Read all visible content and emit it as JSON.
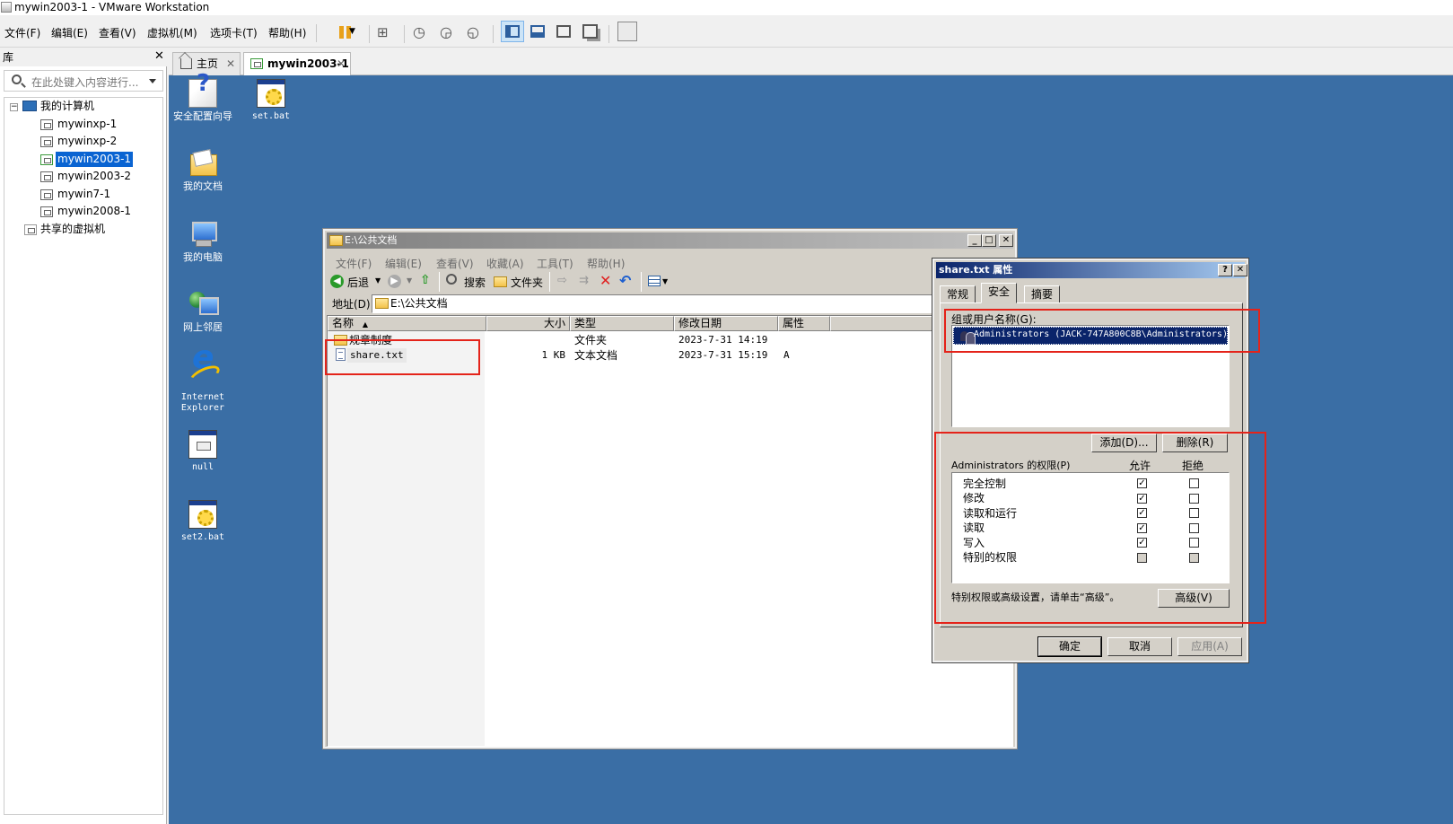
{
  "window": {
    "title": "mywin2003-1 - VMware Workstation"
  },
  "menubar": {
    "items": [
      "文件(F)",
      "编辑(E)",
      "查看(V)",
      "虚拟机(M)",
      "选项卡(T)",
      "帮助(H)"
    ]
  },
  "library": {
    "title": "库",
    "search_placeholder": "在此处键入内容进行...",
    "root": "我的计算机",
    "vms": [
      "mywinxp-1",
      "mywinxp-2",
      "mywin2003-1",
      "mywin2003-2",
      "mywin7-1",
      "mywin2008-1"
    ],
    "selected": "mywin2003-1",
    "shared": "共享的虚拟机"
  },
  "tabs": [
    {
      "label": "主页"
    },
    {
      "label": "mywin2003-1",
      "active": true
    }
  ],
  "desktop_icons": [
    {
      "label": "安全配置向导",
      "icon": "security-wizard-icon"
    },
    {
      "label": "set.bat",
      "icon": "batch-file-icon"
    },
    {
      "label": "我的文档",
      "icon": "my-documents-icon"
    },
    {
      "label": "我的电脑",
      "icon": "my-computer-icon"
    },
    {
      "label": "网上邻居",
      "icon": "network-places-icon"
    },
    {
      "label": "Internet Explorer",
      "icon": "ie-icon"
    },
    {
      "label": "null",
      "icon": "null-file-icon"
    },
    {
      "label": "set2.bat",
      "icon": "batch-file-icon"
    }
  ],
  "explorer": {
    "title": "E:\\公共文档",
    "menu": [
      "文件(F)",
      "编辑(E)",
      "查看(V)",
      "收藏(A)",
      "工具(T)",
      "帮助(H)"
    ],
    "toolbar": {
      "back": "后退",
      "search": "搜索",
      "folders": "文件夹"
    },
    "address_label": "地址(D)",
    "address_value": "E:\\公共文档",
    "columns": [
      "名称",
      "大小",
      "类型",
      "修改日期",
      "属性"
    ],
    "rows": [
      {
        "name": "规章制度",
        "size": "",
        "type": "文件夹",
        "modified": "2023-7-31 14:19",
        "attr": ""
      },
      {
        "name": "share.txt",
        "size": "1 KB",
        "type": "文本文档",
        "modified": "2023-7-31 15:19",
        "attr": "A"
      }
    ]
  },
  "properties": {
    "title": "share.txt 属性",
    "tabs": [
      "常规",
      "安全",
      "摘要"
    ],
    "active_tab": "安全",
    "group_label": "组或用户名称(G):",
    "group_entries": [
      "Administrators (JACK-747A800C8B\\Administrators)"
    ],
    "add_button": "添加(D)...",
    "remove_button": "删除(R)",
    "perm_label": "Administrators 的权限(P)",
    "allow_header": "允许",
    "deny_header": "拒绝",
    "permissions": [
      {
        "name": "完全控制",
        "allow": true,
        "deny": false
      },
      {
        "name": "修改",
        "allow": true,
        "deny": false
      },
      {
        "name": "读取和运行",
        "allow": true,
        "deny": false
      },
      {
        "name": "读取",
        "allow": true,
        "deny": false
      },
      {
        "name": "写入",
        "allow": true,
        "deny": false
      },
      {
        "name": "特别的权限",
        "allow": false,
        "deny": false
      }
    ],
    "advanced_hint": "特别权限或高级设置，请单击“高级”。",
    "advanced_button": "高级(V)",
    "ok": "确定",
    "cancel": "取消",
    "apply": "应用(A)"
  },
  "colors": {
    "desktop": "#3a6ea5",
    "annotation": "#e4231a",
    "selection": "#0a64d2"
  }
}
